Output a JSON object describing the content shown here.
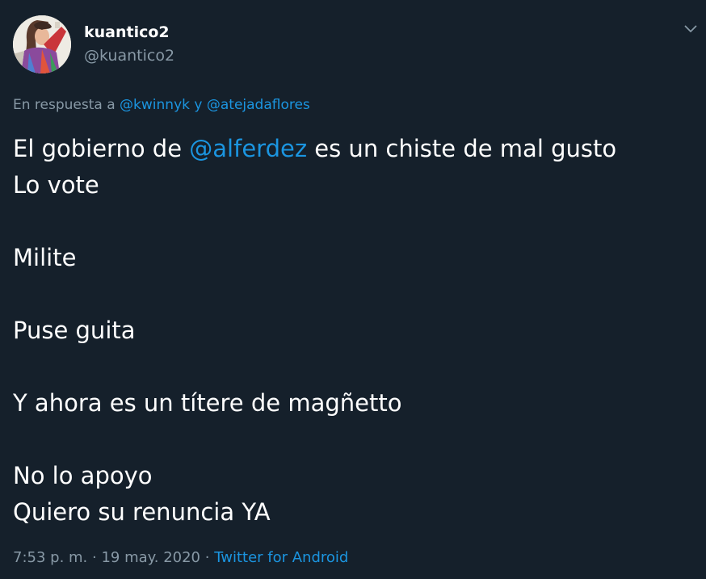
{
  "author": {
    "display_name": "kuantico2",
    "handle": "@kuantico2"
  },
  "reply": {
    "prefix": "En respuesta a",
    "mention_1": "@kwinnyk",
    "connector": "y",
    "mention_2": "@atejadaflores"
  },
  "tweet": {
    "line1_start": "El gobierno de",
    "line1_mention": "@alferdez",
    "line1_end": "es un chiste de mal gusto",
    "line2": "Lo vote",
    "line4": "Milite",
    "line6": "Puse guita",
    "line8": "Y ahora es un títere de magñetto",
    "line10": "No lo apoyo",
    "line11": "Quiero su renuncia YA"
  },
  "meta": {
    "time": "7:53 p. m.",
    "separator_1": "·",
    "date": "19 may. 2020",
    "separator_2": "·",
    "source": "Twitter for Android"
  },
  "icons": {
    "more": "chevron-down-icon"
  },
  "colors": {
    "background": "#15202b",
    "text": "#ffffff",
    "secondary": "#8899a6",
    "link": "#1b95e0"
  }
}
